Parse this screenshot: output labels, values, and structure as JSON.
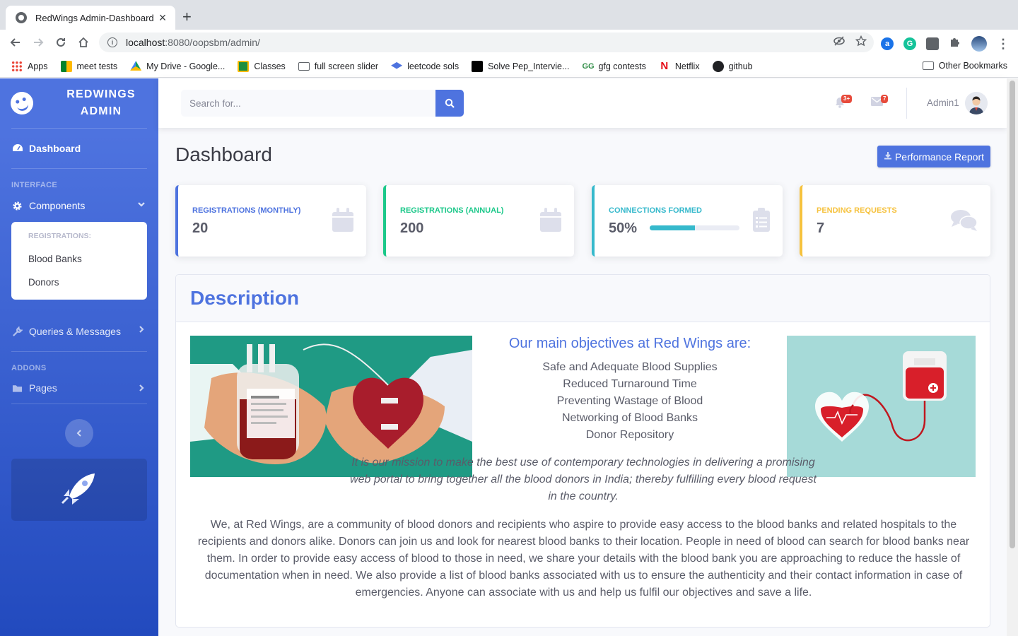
{
  "browser": {
    "tab_title": "RedWings Admin-Dashboard",
    "url_host": "localhost",
    "url_rest": ":8080/oopsbm/admin/",
    "bookmarks": [
      "Apps",
      "meet tests",
      "My Drive - Google...",
      "Classes",
      "full screen slider",
      "leetcode sols",
      "Solve Pep_Intervie...",
      "gfg contests",
      "Netflix",
      "github"
    ],
    "other_bookmarks": "Other Bookmarks"
  },
  "sidebar": {
    "brand": "REDWINGS ADMIN",
    "dashboard": "Dashboard",
    "heading_interface": "INTERFACE",
    "components": "Components",
    "collapse_header": "REGISTRATIONS:",
    "collapse_items": [
      "Blood Banks",
      "Donors"
    ],
    "queries": "Queries & Messages",
    "heading_addons": "ADDONS",
    "pages": "Pages"
  },
  "topbar": {
    "search_placeholder": "Search for...",
    "alerts_badge": "3+",
    "messages_badge": "7",
    "user_name": "Admin1"
  },
  "page": {
    "title": "Dashboard",
    "report_button": "Performance Report"
  },
  "cards": [
    {
      "label": "REGISTRATIONS (MONTHLY)",
      "value": "20",
      "color": "#4e73df",
      "icon": "calendar-icon"
    },
    {
      "label": "REGISTRATIONS (ANNUAL)",
      "value": "200",
      "color": "#1cc88a",
      "icon": "calendar-icon"
    },
    {
      "label": "CONNECTIONS FORMED",
      "value": "50%",
      "progress": 0.5,
      "color": "#36b9cc",
      "icon": "clipboard-list-icon"
    },
    {
      "label": "PENDING REQUESTS",
      "value": "7",
      "color": "#f6c23e",
      "icon": "comments-icon"
    }
  ],
  "description": {
    "title": "Description",
    "objectives_title": "Our main objectives at Red Wings are:",
    "objectives": [
      "Safe and Adequate Blood Supplies",
      "Reduced Turnaround Time",
      "Preventing Wastage of Blood",
      "Networking of Blood Banks",
      "Donor Repository"
    ],
    "mission": "It is our mission to make the best use of contemporary technologies in delivering a promising web portal to bring together all the blood donors in India; thereby fulfilling every blood request in the country.",
    "about": "We, at Red Wings, are a community of blood donors and recipients who aspire to provide easy access to the blood banks and related hospitals to the recipients and donors alike. Donors can join us and look for nearest blood banks to their location. People in need of blood can search for blood banks near them. In order to provide easy access of blood to those in need, we share your details with the blood bank you are approaching to reduce the hassle of documentation when in need. We also provide a list of blood banks associated with us to ensure the authenticity and their contact information in case of emergencies. Anyone can associate with us and help us fulfil our objectives and save a life."
  }
}
